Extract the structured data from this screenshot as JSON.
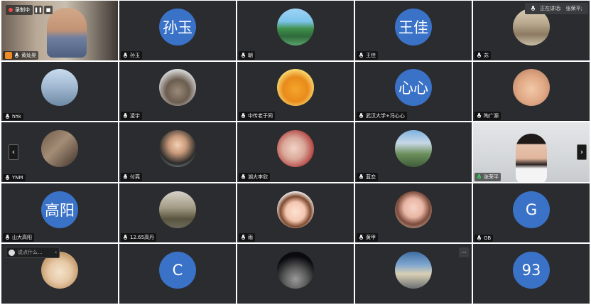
{
  "meeting": {
    "recording_label": "录制中",
    "speaking_label": "正在讲话:",
    "speaking_name": "张荣平;",
    "chat_placeholder": "说点什么...",
    "more_label": "···"
  },
  "participants": [
    {
      "name": "黄灿昊",
      "avatar_text": "",
      "kind": "video-host"
    },
    {
      "name": "孙玉",
      "avatar_text": "孙玉",
      "kind": "text"
    },
    {
      "name": "朝",
      "avatar_text": "",
      "kind": "img-waterfall"
    },
    {
      "name": "王佳",
      "avatar_text": "王佳",
      "kind": "text"
    },
    {
      "name": "苏",
      "avatar_text": "",
      "kind": "img-street"
    },
    {
      "name": "hhk",
      "avatar_text": "",
      "kind": "img-city"
    },
    {
      "name": "凌宇",
      "avatar_text": "",
      "kind": "img-cat"
    },
    {
      "name": "中传老于同",
      "avatar_text": "",
      "kind": "img-toy"
    },
    {
      "name": "武汉大学+冯心心",
      "avatar_text": "心心",
      "kind": "text"
    },
    {
      "name": "陶广源",
      "avatar_text": "",
      "kind": "img-baby"
    },
    {
      "name": "YNM",
      "avatar_text": "",
      "kind": "img-room"
    },
    {
      "name": "付莞",
      "avatar_text": "",
      "kind": "img-cartoon"
    },
    {
      "name": "湖大李欣",
      "avatar_text": "",
      "kind": "img-baby2"
    },
    {
      "name": "蓝恋",
      "avatar_text": "",
      "kind": "img-landscape"
    },
    {
      "name": "张荣平",
      "avatar_text": "",
      "kind": "video-speaker"
    },
    {
      "name": "山大高阳",
      "avatar_text": "高阳",
      "kind": "text"
    },
    {
      "name": "12.65高丹",
      "avatar_text": "",
      "kind": "img-outdoor"
    },
    {
      "name": "雨",
      "avatar_text": "",
      "kind": "img-girl"
    },
    {
      "name": "黄甲",
      "avatar_text": "",
      "kind": "img-woman"
    },
    {
      "name": "GB",
      "avatar_text": "G",
      "kind": "text"
    },
    {
      "name": "",
      "avatar_text": "",
      "kind": "img-dog"
    },
    {
      "name": "",
      "avatar_text": "C",
      "kind": "text"
    },
    {
      "name": "",
      "avatar_text": "",
      "kind": "img-moon"
    },
    {
      "name": "",
      "avatar_text": "",
      "kind": "img-sky"
    },
    {
      "name": "",
      "avatar_text": "93",
      "kind": "text"
    }
  ],
  "colors": {
    "tile_bg": "#2b2c2f",
    "avatar_blue": "#3a72c8",
    "speaker_green": "#3ac15c",
    "record_red": "#e94c4c"
  }
}
